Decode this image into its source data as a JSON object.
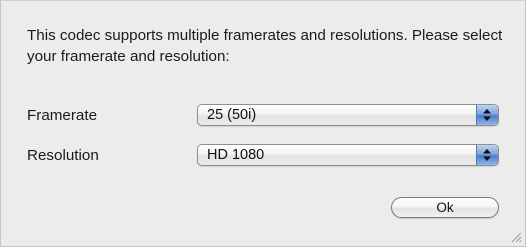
{
  "dialog": {
    "message": "This codec supports multiple framerates and resolutions. Please select your framerate and resolution:"
  },
  "framerate": {
    "label": "Framerate",
    "selected": "25 (50i)"
  },
  "resolution": {
    "label": "Resolution",
    "selected": "HD 1080"
  },
  "buttons": {
    "ok_label": "Ok"
  },
  "icons": {
    "popup_arrows": "up-down-arrows-icon",
    "resize_grip": "resize-grip-icon"
  },
  "colors": {
    "window_background": "#ececec",
    "popup_arrow_accent": "#5a86cf"
  }
}
